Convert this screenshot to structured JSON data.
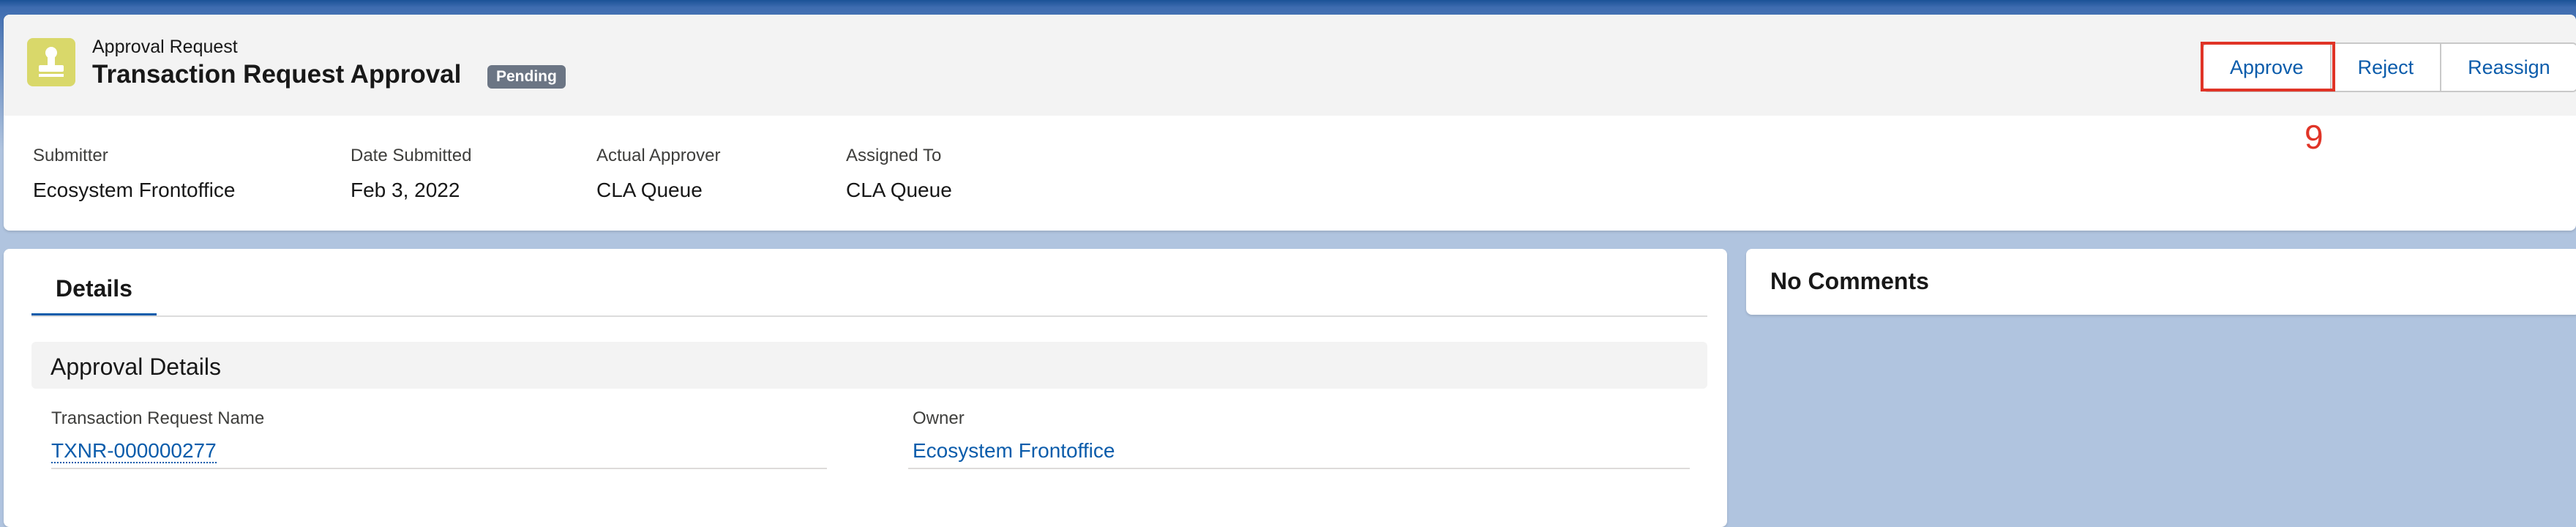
{
  "header": {
    "object_label": "Approval Request",
    "title": "Transaction Request Approval",
    "status": "Pending",
    "icon": "stamp-icon",
    "icon_color": "#d9d86a"
  },
  "actions": {
    "approve": "Approve",
    "reject": "Reject",
    "reassign": "Reassign"
  },
  "annotation": {
    "label": "9",
    "color": "#e03427"
  },
  "highlights": [
    {
      "label": "Submitter",
      "value": "Ecosystem Frontoffice"
    },
    {
      "label": "Date Submitted",
      "value": "Feb 3, 2022"
    },
    {
      "label": "Actual Approver",
      "value": "CLA Queue"
    },
    {
      "label": "Assigned To",
      "value": "CLA Queue"
    }
  ],
  "tabs": [
    {
      "label": "Details",
      "active": true
    }
  ],
  "details": {
    "section_title": "Approval Details",
    "fields": [
      {
        "label": "Transaction Request Name",
        "value": "TXNR-000000277"
      },
      {
        "label": "Owner",
        "value": "Ecosystem Frontoffice"
      }
    ]
  },
  "comments": {
    "title": "No Comments"
  },
  "colors": {
    "brand": "#0b5cab",
    "background": "#b0c4df",
    "status_badge": "#6b7584"
  }
}
